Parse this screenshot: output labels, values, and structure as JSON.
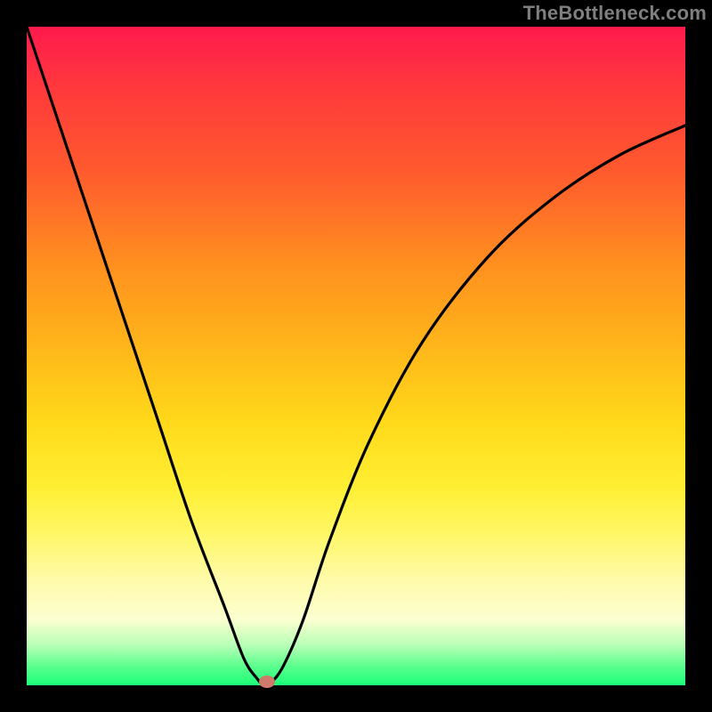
{
  "watermark": "TheBottleneck.com",
  "colors": {
    "frame": "#000000",
    "curve_stroke": "#000000",
    "dot_fill": "#cf7a6b",
    "watermark_text": "#7f7f7f"
  },
  "chart_data": {
    "type": "line",
    "title": "",
    "xlabel": "",
    "ylabel": "",
    "xlim": [
      0,
      100
    ],
    "ylim": [
      0,
      100
    ],
    "x": [
      0,
      5,
      10,
      15,
      20,
      25,
      30,
      33,
      35,
      36,
      37,
      39,
      42,
      46,
      52,
      60,
      70,
      80,
      90,
      100
    ],
    "values": [
      100,
      85.0,
      70.0,
      55.0,
      40.0,
      25.0,
      12.0,
      4.0,
      1.0,
      0.0,
      0.3,
      3.0,
      10.0,
      22.0,
      37.0,
      52.0,
      65.0,
      74.0,
      80.5,
      85.0
    ],
    "minimum_point": {
      "x": 36,
      "y": 0
    },
    "annotations": [
      {
        "kind": "dot",
        "x": 36.5,
        "y": 0.5
      }
    ],
    "background_gradient": {
      "direction": "vertical",
      "stops": [
        {
          "pos": 0.0,
          "color": "#ff1a4d"
        },
        {
          "pos": 0.5,
          "color": "#ffd91a"
        },
        {
          "pos": 0.85,
          "color": "#fffbaa"
        },
        {
          "pos": 1.0,
          "color": "#1aff77"
        }
      ]
    }
  }
}
